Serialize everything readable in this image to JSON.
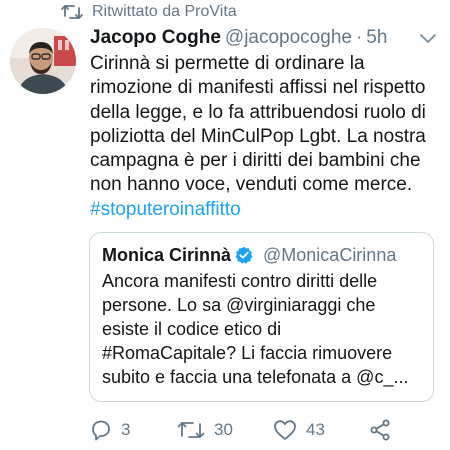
{
  "retweet": {
    "label": "Ritwittato da ProVita",
    "icon": "retweet-icon"
  },
  "tweet": {
    "author_name": "Jacopo Coghe",
    "author_handle": "@jacopocoghe",
    "separator": "·",
    "timestamp": "5h",
    "avatar_icon": "avatar",
    "menu_icon": "chevron-down-icon",
    "text_lines": [
      "Cirinnà si permette di ordinare la",
      "rimozione di manifesti affissi nel rispetto",
      "della legge, e lo fa attribuendosi ruolo di",
      "poliziotta del MinCulPop Lgbt. La nostra",
      "campagna è per i diritti dei bambini che",
      "non hanno voce, venduti come merce."
    ],
    "hashtag": "#stoputeroinaffitto"
  },
  "quote": {
    "author_name": "Monica Cirinnà",
    "verified_icon": "verified-badge-icon",
    "author_handle": "@MonicaCirinna",
    "text_lines": [
      "Ancora manifesti contro diritti delle",
      "persone. Lo sa @virginiaraggi che",
      "esiste il codice etico di",
      "#RomaCapitale? Li faccia rimuovere",
      "subito e faccia una telefonata a @c_..."
    ]
  },
  "actions": {
    "reply": {
      "icon": "reply-icon",
      "count": "3"
    },
    "retweet": {
      "icon": "retweet-icon",
      "count": "30"
    },
    "like": {
      "icon": "heart-icon",
      "count": "43"
    },
    "share": {
      "icon": "share-icon"
    }
  },
  "colors": {
    "text": "#14171a",
    "secondary": "#657786",
    "link": "#1da1f2",
    "border": "#ccd6dd",
    "verified": "#1da1f2"
  }
}
